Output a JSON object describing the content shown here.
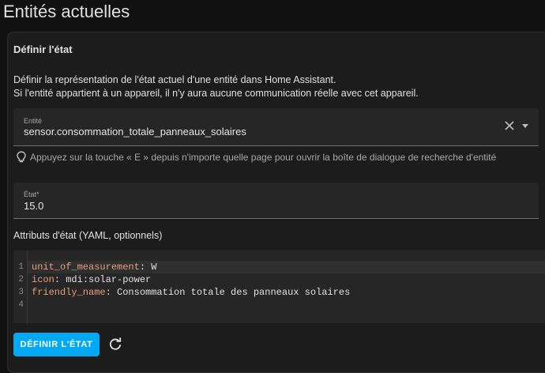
{
  "header": {
    "title": "Entités actuelles"
  },
  "card": {
    "title": "Définir l'état",
    "description_line1": "Définir la représentation de l'état actuel d'une entité dans Home Assistant.",
    "description_line2": "Si l'entité appartient à un appareil, il n'y aura aucune communication réelle avec cet appareil."
  },
  "entity_field": {
    "label": "Entité",
    "value": "sensor.consommation_totale_panneaux_solaires",
    "clear_icon": "close-icon",
    "dropdown_icon": "chevron-down-icon"
  },
  "hint": {
    "icon": "lightbulb-icon",
    "text": "Appuyez sur la touche « E » depuis n'importe quelle page pour ouvrir la boîte de dialogue de recherche d'entité"
  },
  "state_field": {
    "label": "État*",
    "value": "15.0"
  },
  "attributes": {
    "label": "Attributs d'état (YAML, optionnels)",
    "lines": [
      {
        "number": "1",
        "key": "unit_of_measurement",
        "value": ": W"
      },
      {
        "number": "2",
        "key": "icon",
        "value": ": mdi:solar-power"
      },
      {
        "number": "3",
        "key": "friendly_name",
        "value": ": Consommation totale des panneaux solaires"
      },
      {
        "number": "4",
        "key": "",
        "value": ""
      }
    ]
  },
  "actions": {
    "set_state_label": "DÉFINIR L'ÉTAT",
    "refresh_icon": "refresh-icon"
  },
  "colors": {
    "primary": "#03a9f4",
    "background": "#111111",
    "card": "#1c1c1c",
    "yaml_key": "#e8a07a"
  }
}
